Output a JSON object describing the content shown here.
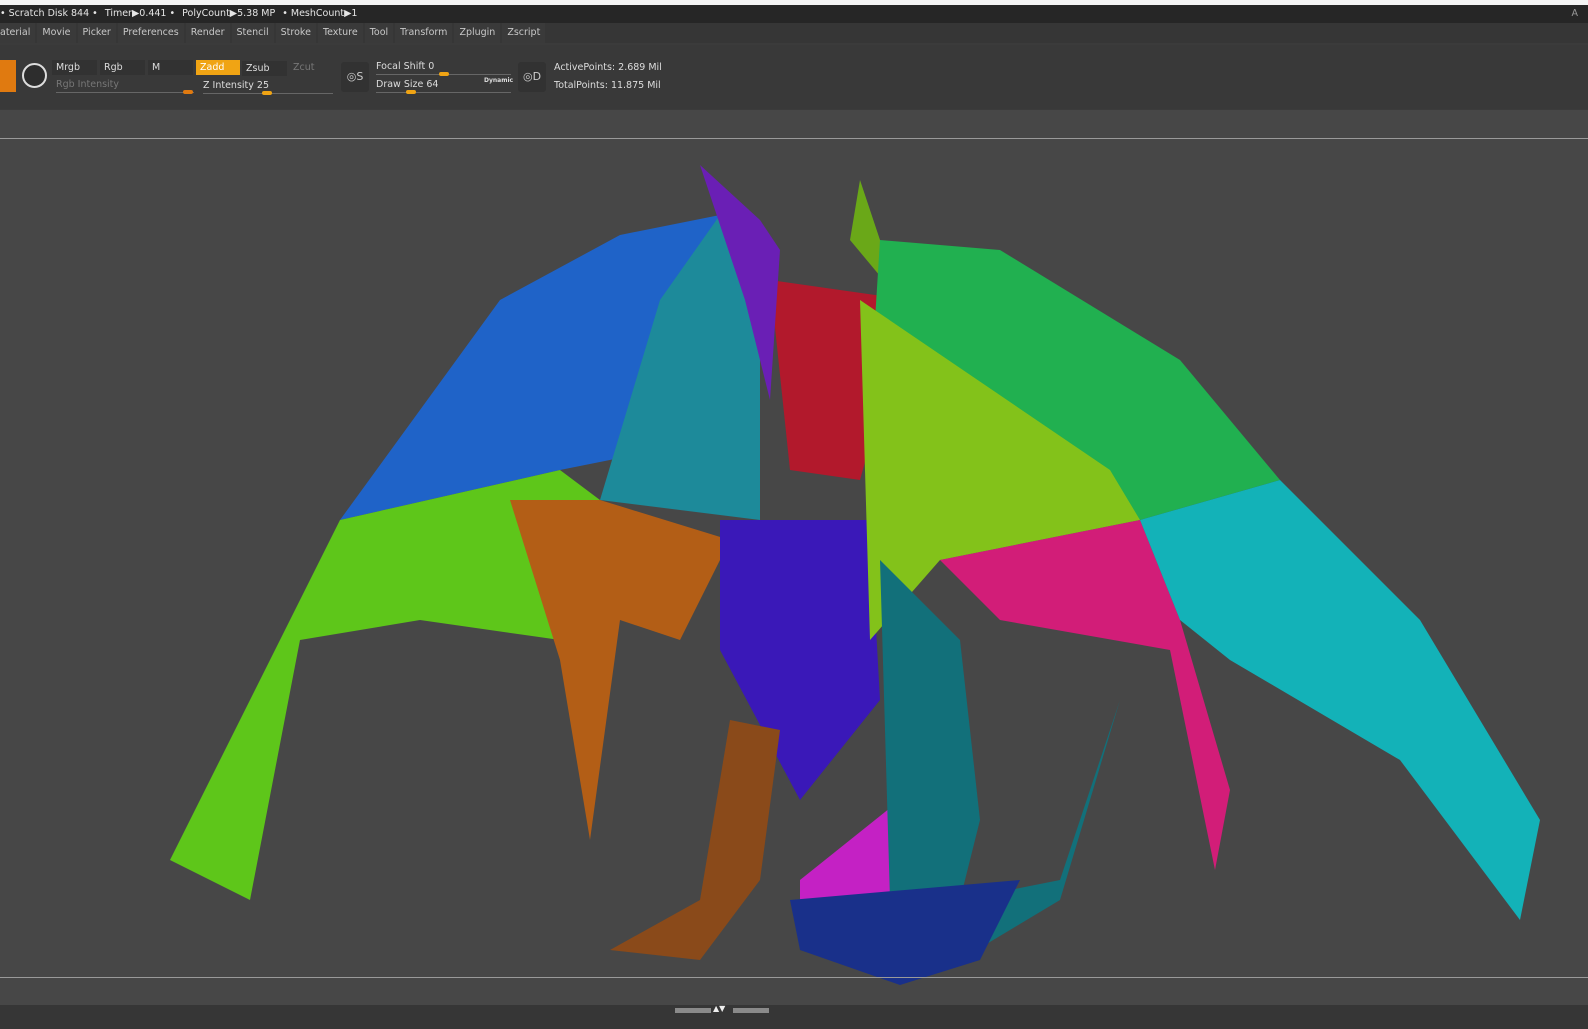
{
  "status": {
    "items": [
      "• Scratch Disk 844 •",
      "Timer▶0.441 •",
      "PolyCount▶5.38 MP",
      "• MeshCount▶1"
    ],
    "right": "A"
  },
  "menu": [
    "aterial",
    "Movie",
    "Picker",
    "Preferences",
    "Render",
    "Stencil",
    "Stroke",
    "Texture",
    "Tool",
    "Transform",
    "Zplugin",
    "Zscript"
  ],
  "shelf": {
    "mrgb": "Mrgb",
    "rgb": "Rgb",
    "m": "M",
    "zadd": "Zadd",
    "zsub": "Zsub",
    "zcut": "Zcut",
    "rgb_intensity": "Rgb Intensity",
    "z_intensity": "Z Intensity 25",
    "focal_shift": "Focal Shift 0",
    "draw_size": "Draw Size 64",
    "dynamic": "Dynamic",
    "s_icon_label": "S",
    "d_icon_label": "D",
    "active_points": "ActivePoints: 2.689 Mil",
    "total_points": "TotalPoints: 11.875 Mil",
    "rgb_intensity_value": 100,
    "z_intensity_value": 25,
    "focal_shift_value": 0,
    "draw_size_value": 64,
    "accent": "#f0a414"
  }
}
